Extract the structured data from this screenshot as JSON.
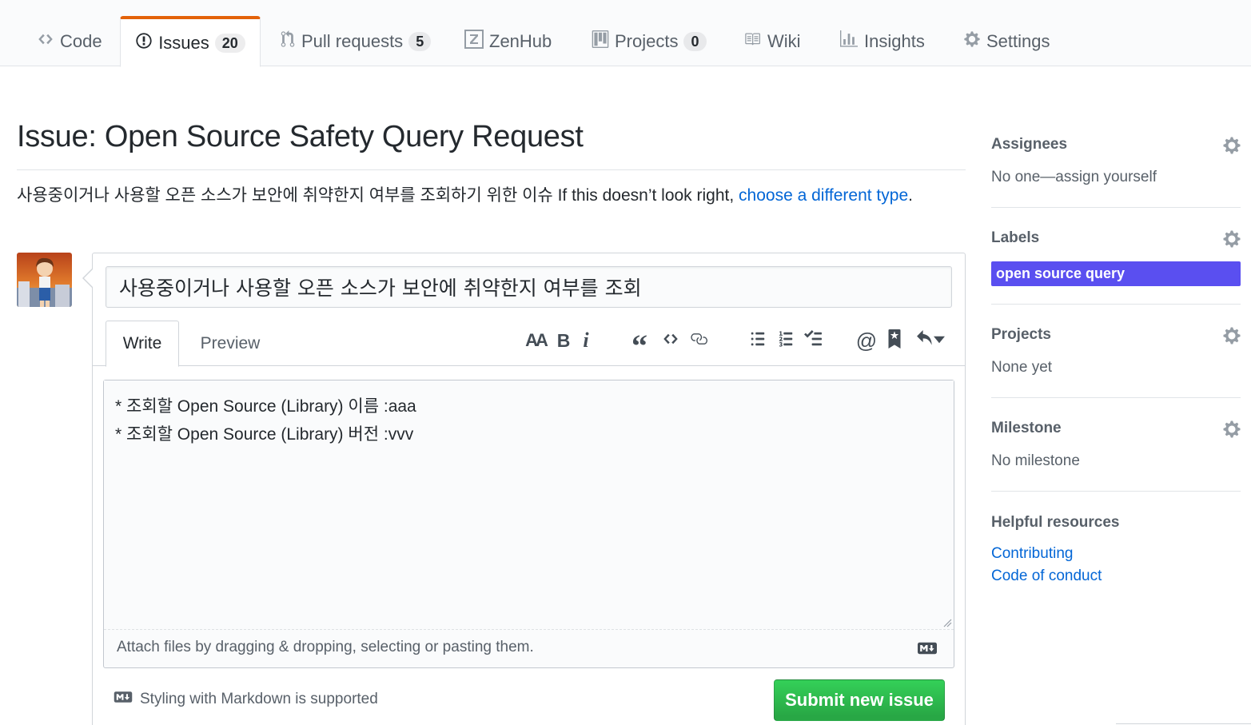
{
  "nav": {
    "tabs": [
      {
        "label": "Code",
        "icon": "code-icon"
      },
      {
        "label": "Issues",
        "count": "20",
        "icon": "issue-opened-icon"
      },
      {
        "label": "Pull requests",
        "count": "5",
        "icon": "git-pull-request-icon"
      },
      {
        "label": "ZenHub",
        "icon": "zenhub-icon"
      },
      {
        "label": "Projects",
        "count": "0",
        "icon": "project-icon"
      },
      {
        "label": "Wiki",
        "icon": "book-icon"
      },
      {
        "label": "Insights",
        "icon": "graph-icon"
      },
      {
        "label": "Settings",
        "icon": "gear-icon"
      }
    ],
    "accent_color": "#e36209"
  },
  "issue": {
    "page_title": "Issue: Open Source Safety Query Request",
    "description": "사용중이거나 사용할 오픈 소스가 보안에 취약한지 여부를 조회하기 위한 이슈 If this doesn’t look right, ",
    "description_link": "choose a different type",
    "description_end": ".",
    "title_value": "사용중이거나 사용할 오픈 소스가 보안에 취약한지 여부를 조회",
    "body_value": "* 조회할 Open Source (Library) 이름 :aaa\n* 조회할 Open Source (Library) 버전 :vvv"
  },
  "editor": {
    "write_tab": "Write",
    "preview_tab": "Preview",
    "toolbar": {
      "header": "AA",
      "bold": "B",
      "italic": "i",
      "quote": "“",
      "code": "<>",
      "mention": "@"
    },
    "attach_hint": "Attach files by dragging & dropping, selecting or pasting them.",
    "markdown_note": "Styling with Markdown is supported",
    "submit_label": "Submit new issue",
    "submit_color": "#28a745"
  },
  "sidebar": {
    "assignees": {
      "heading": "Assignees",
      "value": "No one—assign yourself"
    },
    "labels": {
      "heading": "Labels",
      "chip": "open source query",
      "chip_color": "#5a4ff0"
    },
    "projects": {
      "heading": "Projects",
      "value": "None yet"
    },
    "milestone": {
      "heading": "Milestone",
      "value": "No milestone"
    },
    "resources": {
      "heading": "Helpful resources",
      "links": [
        "Contributing",
        "Code of conduct"
      ]
    }
  }
}
